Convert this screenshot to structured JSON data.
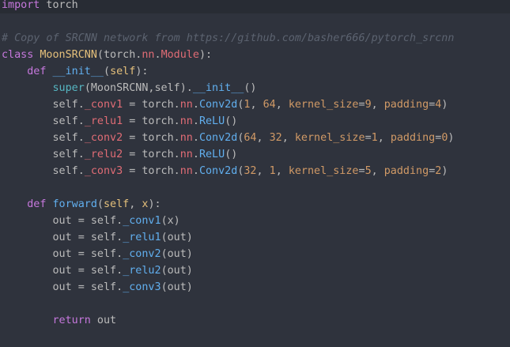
{
  "editor": {
    "lines": [
      {
        "tokens": [
          {
            "t": "import",
            "c": "kw"
          },
          {
            "t": " torch",
            "c": "plain"
          }
        ]
      },
      {
        "tokens": []
      },
      {
        "tokens": [
          {
            "t": "# Copy of SRCNN network from https://github.com/basher666/pytorch_srcnn",
            "c": "cm"
          }
        ]
      },
      {
        "tokens": [
          {
            "t": "class",
            "c": "kw"
          },
          {
            "t": " ",
            "c": "plain"
          },
          {
            "t": "MoonSRCNN",
            "c": "cls"
          },
          {
            "t": "(torch.",
            "c": "plain"
          },
          {
            "t": "nn",
            "c": "attr"
          },
          {
            "t": ".",
            "c": "plain"
          },
          {
            "t": "Module",
            "c": "attr"
          },
          {
            "t": "):",
            "c": "plain"
          }
        ]
      },
      {
        "tokens": [
          {
            "t": "    ",
            "c": "plain"
          },
          {
            "t": "def",
            "c": "kw"
          },
          {
            "t": " ",
            "c": "plain"
          },
          {
            "t": "__init__",
            "c": "fn"
          },
          {
            "t": "(",
            "c": "plain"
          },
          {
            "t": "self",
            "c": "self"
          },
          {
            "t": "):",
            "c": "plain"
          }
        ]
      },
      {
        "tokens": [
          {
            "t": "        ",
            "c": "plain"
          },
          {
            "t": "super",
            "c": "builtin"
          },
          {
            "t": "(MoonSRCNN,self).",
            "c": "plain"
          },
          {
            "t": "__init__",
            "c": "call"
          },
          {
            "t": "()",
            "c": "plain"
          }
        ]
      },
      {
        "tokens": [
          {
            "t": "        self.",
            "c": "plain"
          },
          {
            "t": "_conv1",
            "c": "attr"
          },
          {
            "t": " = torch.",
            "c": "plain"
          },
          {
            "t": "nn",
            "c": "attr"
          },
          {
            "t": ".",
            "c": "plain"
          },
          {
            "t": "Conv2d",
            "c": "call"
          },
          {
            "t": "(",
            "c": "plain"
          },
          {
            "t": "1",
            "c": "num"
          },
          {
            "t": ", ",
            "c": "plain"
          },
          {
            "t": "64",
            "c": "num"
          },
          {
            "t": ", ",
            "c": "plain"
          },
          {
            "t": "kernel_size",
            "c": "kwarg"
          },
          {
            "t": "=",
            "c": "plain"
          },
          {
            "t": "9",
            "c": "num"
          },
          {
            "t": ", ",
            "c": "plain"
          },
          {
            "t": "padding",
            "c": "kwarg"
          },
          {
            "t": "=",
            "c": "plain"
          },
          {
            "t": "4",
            "c": "num"
          },
          {
            "t": ")",
            "c": "plain"
          }
        ]
      },
      {
        "tokens": [
          {
            "t": "        self.",
            "c": "plain"
          },
          {
            "t": "_relu1",
            "c": "attr"
          },
          {
            "t": " = torch.",
            "c": "plain"
          },
          {
            "t": "nn",
            "c": "attr"
          },
          {
            "t": ".",
            "c": "plain"
          },
          {
            "t": "ReLU",
            "c": "call"
          },
          {
            "t": "()",
            "c": "plain"
          }
        ]
      },
      {
        "tokens": [
          {
            "t": "        self.",
            "c": "plain"
          },
          {
            "t": "_conv2",
            "c": "attr"
          },
          {
            "t": " = torch.",
            "c": "plain"
          },
          {
            "t": "nn",
            "c": "attr"
          },
          {
            "t": ".",
            "c": "plain"
          },
          {
            "t": "Conv2d",
            "c": "call"
          },
          {
            "t": "(",
            "c": "plain"
          },
          {
            "t": "64",
            "c": "num"
          },
          {
            "t": ", ",
            "c": "plain"
          },
          {
            "t": "32",
            "c": "num"
          },
          {
            "t": ", ",
            "c": "plain"
          },
          {
            "t": "kernel_size",
            "c": "kwarg"
          },
          {
            "t": "=",
            "c": "plain"
          },
          {
            "t": "1",
            "c": "num"
          },
          {
            "t": ", ",
            "c": "plain"
          },
          {
            "t": "padding",
            "c": "kwarg"
          },
          {
            "t": "=",
            "c": "plain"
          },
          {
            "t": "0",
            "c": "num"
          },
          {
            "t": ")",
            "c": "plain"
          }
        ]
      },
      {
        "tokens": [
          {
            "t": "        self.",
            "c": "plain"
          },
          {
            "t": "_relu2",
            "c": "attr"
          },
          {
            "t": " = torch.",
            "c": "plain"
          },
          {
            "t": "nn",
            "c": "attr"
          },
          {
            "t": ".",
            "c": "plain"
          },
          {
            "t": "ReLU",
            "c": "call"
          },
          {
            "t": "()",
            "c": "plain"
          }
        ]
      },
      {
        "tokens": [
          {
            "t": "        self.",
            "c": "plain"
          },
          {
            "t": "_conv3",
            "c": "attr"
          },
          {
            "t": " = torch.",
            "c": "plain"
          },
          {
            "t": "nn",
            "c": "attr"
          },
          {
            "t": ".",
            "c": "plain"
          },
          {
            "t": "Conv2d",
            "c": "call"
          },
          {
            "t": "(",
            "c": "plain"
          },
          {
            "t": "32",
            "c": "num"
          },
          {
            "t": ", ",
            "c": "plain"
          },
          {
            "t": "1",
            "c": "num"
          },
          {
            "t": ", ",
            "c": "plain"
          },
          {
            "t": "kernel_size",
            "c": "kwarg"
          },
          {
            "t": "=",
            "c": "plain"
          },
          {
            "t": "5",
            "c": "num"
          },
          {
            "t": ", ",
            "c": "plain"
          },
          {
            "t": "padding",
            "c": "kwarg"
          },
          {
            "t": "=",
            "c": "plain"
          },
          {
            "t": "2",
            "c": "num"
          },
          {
            "t": ")",
            "c": "plain"
          }
        ]
      },
      {
        "tokens": []
      },
      {
        "tokens": [
          {
            "t": "    ",
            "c": "plain"
          },
          {
            "t": "def",
            "c": "kw"
          },
          {
            "t": " ",
            "c": "plain"
          },
          {
            "t": "forward",
            "c": "fn"
          },
          {
            "t": "(",
            "c": "plain"
          },
          {
            "t": "self",
            "c": "self"
          },
          {
            "t": ", ",
            "c": "plain"
          },
          {
            "t": "x",
            "c": "self"
          },
          {
            "t": "):",
            "c": "plain"
          }
        ]
      },
      {
        "tokens": [
          {
            "t": "        out = self.",
            "c": "plain"
          },
          {
            "t": "_conv1",
            "c": "call"
          },
          {
            "t": "(x)",
            "c": "plain"
          }
        ]
      },
      {
        "tokens": [
          {
            "t": "        out = self.",
            "c": "plain"
          },
          {
            "t": "_relu1",
            "c": "call"
          },
          {
            "t": "(out)",
            "c": "plain"
          }
        ]
      },
      {
        "tokens": [
          {
            "t": "        out = self.",
            "c": "plain"
          },
          {
            "t": "_conv2",
            "c": "call"
          },
          {
            "t": "(out)",
            "c": "plain"
          }
        ]
      },
      {
        "tokens": [
          {
            "t": "        out = self.",
            "c": "plain"
          },
          {
            "t": "_relu2",
            "c": "call"
          },
          {
            "t": "(out)",
            "c": "plain"
          }
        ]
      },
      {
        "tokens": [
          {
            "t": "        out = self.",
            "c": "plain"
          },
          {
            "t": "_conv3",
            "c": "call"
          },
          {
            "t": "(out)",
            "c": "plain"
          }
        ]
      },
      {
        "tokens": []
      },
      {
        "tokens": [
          {
            "t": "        ",
            "c": "plain"
          },
          {
            "t": "return",
            "c": "kw"
          },
          {
            "t": " out",
            "c": "plain"
          }
        ]
      }
    ]
  }
}
